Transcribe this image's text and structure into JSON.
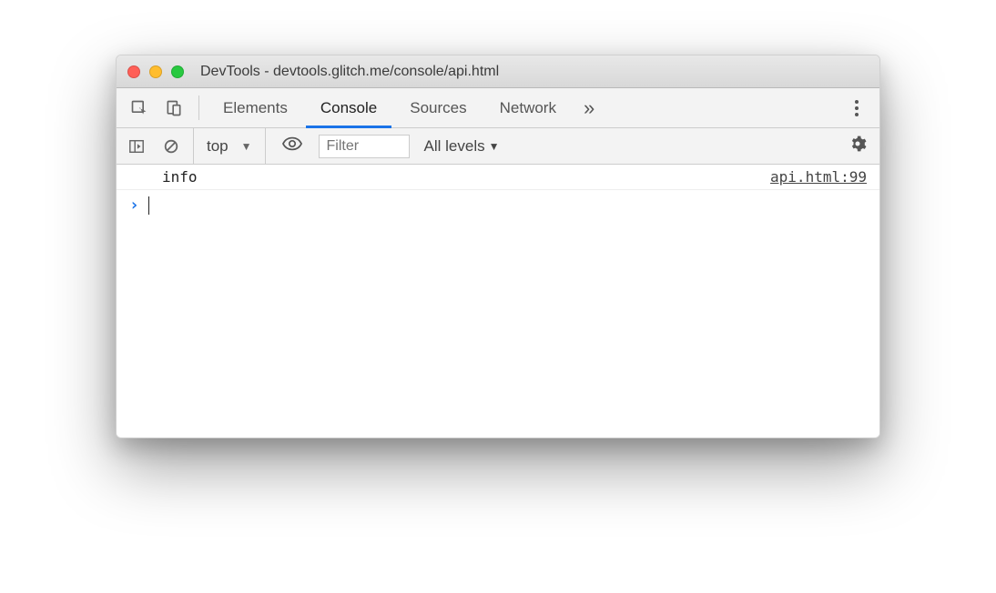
{
  "window": {
    "title": "DevTools - devtools.glitch.me/console/api.html"
  },
  "tabs": {
    "items": [
      "Elements",
      "Console",
      "Sources",
      "Network"
    ],
    "active_index": 1,
    "overflow_glyph": "»"
  },
  "toolbar": {
    "context": "top",
    "filter_placeholder": "Filter",
    "levels_label": "All levels"
  },
  "console": {
    "rows": [
      {
        "message": "info",
        "source": "api.html:99"
      }
    ],
    "prompt_glyph": "›"
  }
}
